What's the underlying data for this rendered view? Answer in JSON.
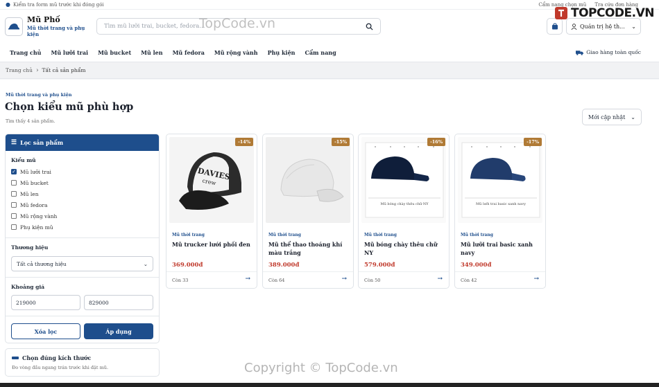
{
  "topbar": {
    "notice": "Kiểm tra form mũ trước khi đóng gói",
    "links": [
      "Cẩm nang chọn mũ",
      "Tra cứu đơn hàng"
    ]
  },
  "header": {
    "brand_name": "Mũ Phố",
    "brand_tagline": "Mũ thời trang và phụ kiện",
    "search_placeholder": "Tìm mũ lưỡi trai, bucket, fedora...",
    "user_label": "Quản trị hệ th..."
  },
  "nav": {
    "items": [
      "Trang chủ",
      "Mũ lưỡi trai",
      "Mũ bucket",
      "Mũ len",
      "Mũ fedora",
      "Mũ rộng vành",
      "Phụ kiện",
      "Cẩm nang"
    ],
    "shipping": "Giao hàng toàn quốc"
  },
  "breadcrumb": {
    "home": "Trang chủ",
    "current": "Tất cả sản phẩm"
  },
  "main": {
    "eyebrow": "Mũ thời trang và phụ kiện",
    "title": "Chọn kiểu mũ phù hợp",
    "count": "Tìm thấy 4 sản phẩm.",
    "sort": "Mới cập nhật"
  },
  "filter": {
    "title": "Lọc sản phẩm",
    "type_title": "Kiểu mũ",
    "types": [
      {
        "label": "Mũ lưỡi trai",
        "checked": true
      },
      {
        "label": "Mũ bucket",
        "checked": false
      },
      {
        "label": "Mũ len",
        "checked": false
      },
      {
        "label": "Mũ fedora",
        "checked": false
      },
      {
        "label": "Mũ rộng vành",
        "checked": false
      },
      {
        "label": "Phụ kiện mũ",
        "checked": false
      }
    ],
    "brand_title": "Thương hiệu",
    "brand_value": "Tất cả thương hiệu",
    "price_title": "Khoảng giá",
    "price_min": "219000",
    "price_max": "829000",
    "clear": "Xóa lọc",
    "apply": "Áp dụng"
  },
  "size_box": {
    "title": "Chọn đúng kích thước",
    "subtitle": "Đo vòng đầu ngang trán trước khi đặt mũ."
  },
  "products": [
    {
      "badge": "-14%",
      "category": "Mũ thời trang",
      "name": "Mũ trucker lưới phối đen",
      "price": "369.000đ",
      "stock": "Còn 33",
      "img_text": "DAVIES CREW",
      "color": "#1a1a1a"
    },
    {
      "badge": "-15%",
      "category": "Mũ thời trang",
      "name": "Mũ thể thao thoáng khí màu trắng",
      "price": "389.000đ",
      "stock": "Còn 64",
      "img_text": "",
      "color": "#e6e6e6"
    },
    {
      "badge": "-16%",
      "category": "Mũ thời trang",
      "name": "Mũ bóng chày thêu chữ NY",
      "price": "579.000đ",
      "stock": "Còn 50",
      "img_text": "Mũ bóng chày thêu chữ NY",
      "color": "#0f1e3a"
    },
    {
      "badge": "-17%",
      "category": "Mũ thời trang",
      "name": "Mũ lưỡi trai basic xanh navy",
      "price": "349.000đ",
      "stock": "Còn 42",
      "img_text": "Mũ lưỡi trai basic xanh navy",
      "color": "#213c6b"
    }
  ],
  "watermarks": {
    "top": "TopCode.vn",
    "bottom": "Copyright © TopCode.vn",
    "brand": "TOPCODE.VN"
  },
  "colors": {
    "primary": "#1e4e8c",
    "badge": "#b07a35",
    "price": "#c0392b"
  }
}
